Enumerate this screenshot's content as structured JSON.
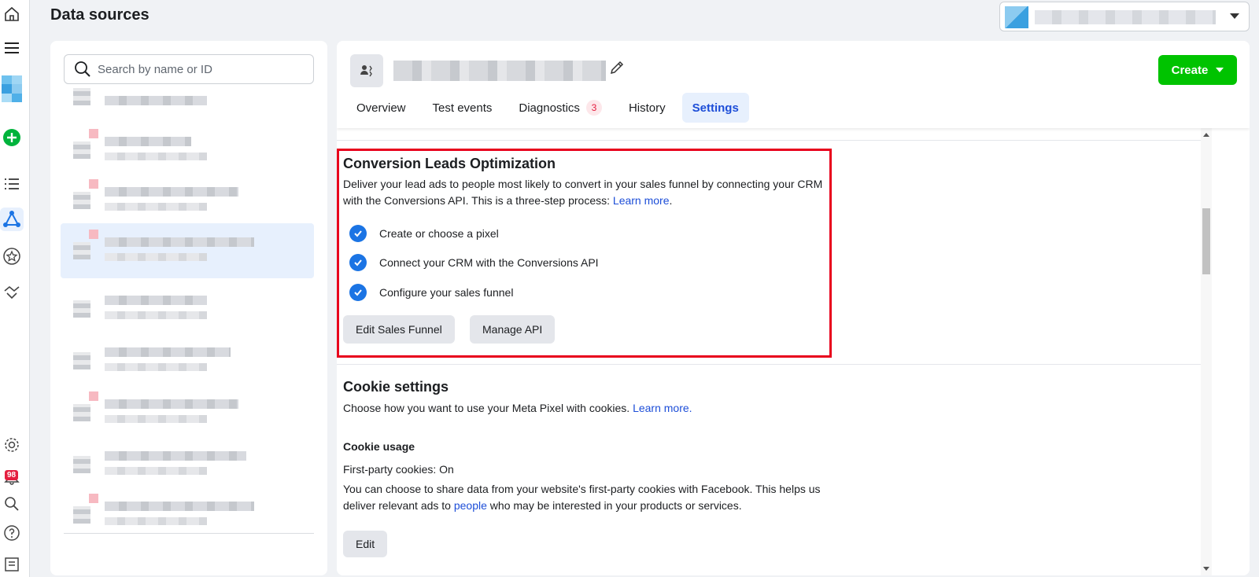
{
  "page": {
    "title": "Data sources"
  },
  "account": {
    "name": ""
  },
  "rail": {
    "icons": [
      "home-icon",
      "menu-icon",
      "business-logo-icon",
      "add-icon",
      "list-icon",
      "data-sources-icon",
      "star-icon",
      "partners-icon",
      "gear-icon",
      "bell-icon",
      "search-icon",
      "help-icon",
      "reports-icon"
    ],
    "notification_count": "98"
  },
  "search": {
    "placeholder": "Search by name or ID"
  },
  "source_list": {
    "count": 9,
    "selected_index": 3
  },
  "header": {
    "create_label": "Create",
    "tabs": [
      {
        "label": "Overview"
      },
      {
        "label": "Test events"
      },
      {
        "label": "Diagnostics",
        "count": "3"
      },
      {
        "label": "History"
      },
      {
        "label": "Settings",
        "active": true
      }
    ]
  },
  "clo": {
    "title": "Conversion Leads Optimization",
    "desc": "Deliver your lead ads to people most likely to convert in your sales funnel by connecting your CRM with the Conversions API. This is a three-step process: ",
    "learn_more": "Learn more",
    "period": ".",
    "steps": [
      "Create or choose a pixel",
      "Connect your CRM with the Conversions API",
      "Configure your sales funnel"
    ],
    "edit_funnel_label": "Edit Sales Funnel",
    "manage_api_label": "Manage API"
  },
  "cookie": {
    "title": "Cookie settings",
    "desc": "Choose how you want to use your Meta Pixel with cookies. ",
    "learn_more": "Learn more.",
    "usage_heading": "Cookie usage",
    "first_party_status": "First-party cookies: On",
    "info_part1": "You can choose to share data from your website's first-party cookies with Facebook. This helps us deliver relevant ads to ",
    "info_link": "people",
    "info_part2": " who may be interested in your products or services.",
    "edit_label": "Edit"
  },
  "colors": {
    "accent": "#1b74e4",
    "create_green": "#00c300",
    "highlight_red": "#e8001c",
    "link": "#1d4ed8"
  }
}
